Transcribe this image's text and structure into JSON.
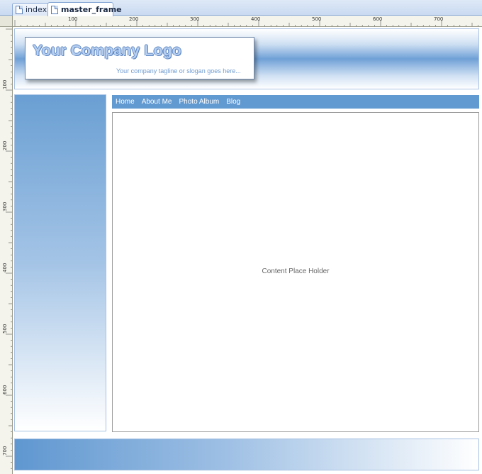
{
  "tabs": [
    {
      "label": "index",
      "active": false
    },
    {
      "label": "master_frame",
      "active": true
    }
  ],
  "ruler_top_labels": [
    "100",
    "200",
    "300",
    "400",
    "500",
    "600",
    "700"
  ],
  "ruler_left_labels": [
    "100",
    "200",
    "300",
    "400",
    "500",
    "600",
    "700"
  ],
  "header": {
    "logo": "Your Company Logo",
    "tagline": "Your company tagline or slogan goes here..."
  },
  "nav": {
    "items": [
      "Home",
      "About Me",
      "Photo Album",
      "Blog"
    ]
  },
  "content": {
    "placeholder": "Content Place Holder"
  },
  "colors": {
    "accent": "#6199d1",
    "logo_fill": "#b6cff0",
    "tagline": "#6e9bd2"
  }
}
